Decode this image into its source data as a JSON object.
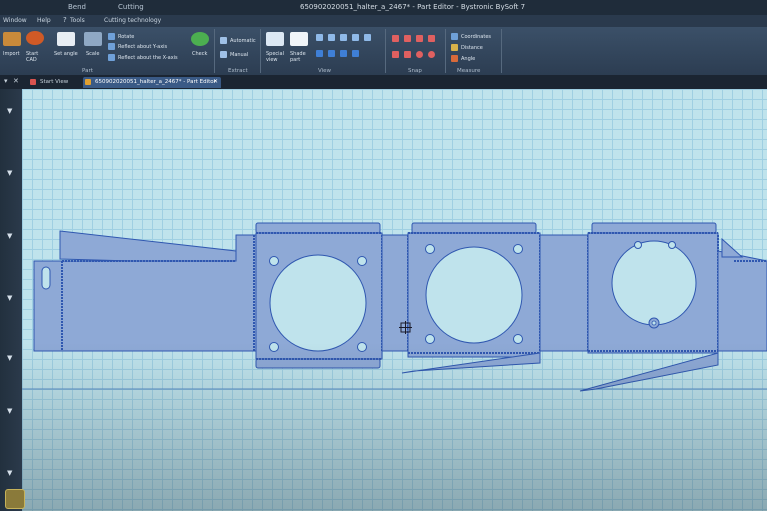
{
  "titlebar": {
    "menu_bend": "Bend",
    "menu_cutting": "Cutting",
    "title": "650902020051_halter_a_2467* - Part Editor - Bystronic BySoft 7"
  },
  "menubar": {
    "window": "Window",
    "help": "Help",
    "tools": "Tools",
    "cutting_technology": "Cutting technology"
  },
  "ribbon": {
    "part_group": {
      "label": "Part",
      "import": "Import",
      "start_cad": "Start CAD",
      "set_angle": "Set angle",
      "scale": "Scale",
      "rotate": "Rotate",
      "reflect_y": "Reflect about Y-axis",
      "reflect_x": "Reflect about the X-axis",
      "check": "Check"
    },
    "extract_group": {
      "label": "Extract",
      "automatic": "Automatic",
      "manual": "Manual"
    },
    "view_group": {
      "label": "View",
      "special_view": "Special view",
      "shade_part": "Shade part"
    },
    "snap_group": {
      "label": "Snap"
    },
    "measure_group": {
      "label": "Measure",
      "coordinates": "Coordinates",
      "distance": "Distance",
      "angle": "Angle"
    }
  },
  "tabs": [
    {
      "label": "Start View",
      "active": false
    },
    {
      "label": "650902020051_halter_a_2467* - Part Editor",
      "active": true
    }
  ],
  "colors": {
    "canvas_bg": "#bfe3ec",
    "grid": "#9fcfe2",
    "part_fill": "#8ea9d6",
    "part_edge": "#2f57b0",
    "ribbon": "#34495f"
  }
}
